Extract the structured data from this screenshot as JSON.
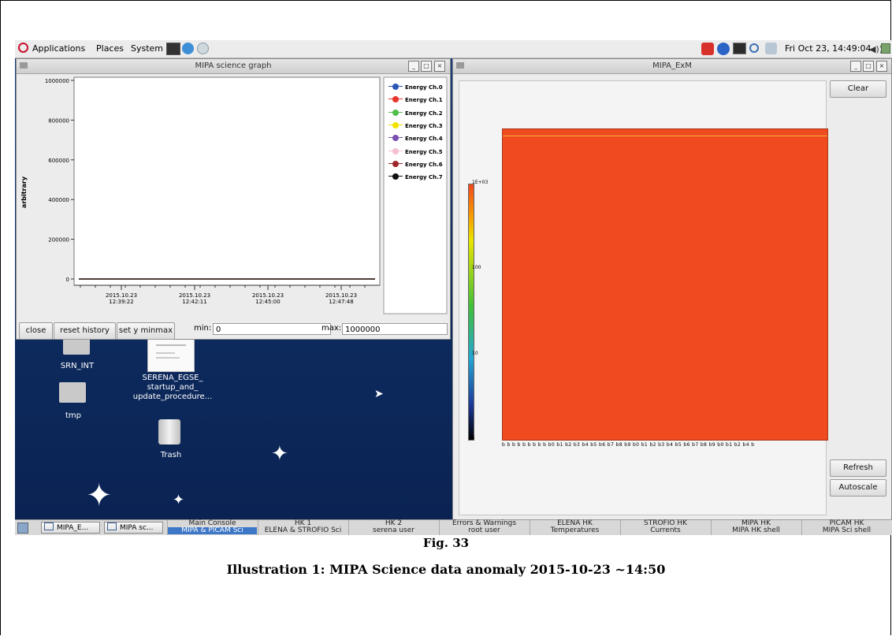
{
  "topbar": {
    "menus": [
      "Applications",
      "Places",
      "System"
    ],
    "clock": "Fri Oct 23, 14:49:04"
  },
  "graph_window": {
    "title": "MIPA science graph",
    "ylabel": "arbitrary",
    "yticks": [
      "1000000",
      "800000",
      "600000",
      "400000",
      "200000",
      "0"
    ],
    "xticks": [
      {
        "date": "2015.10.23",
        "time": "12:39:22"
      },
      {
        "date": "2015.10.23",
        "time": "12:42:11"
      },
      {
        "date": "2015.10.23",
        "time": "12:45:00"
      },
      {
        "date": "2015.10.23",
        "time": "12:47:48"
      }
    ],
    "legend": [
      {
        "label": "Energy Ch.0",
        "color": "#2b56b8"
      },
      {
        "label": "Energy Ch.1",
        "color": "#e8352a"
      },
      {
        "label": "Energy Ch.2",
        "color": "#4fbf4a"
      },
      {
        "label": "Energy Ch.3",
        "color": "#f2e200"
      },
      {
        "label": "Energy Ch.4",
        "color": "#7a4fb0"
      },
      {
        "label": "Energy Ch.5",
        "color": "#f4c0cf"
      },
      {
        "label": "Energy Ch.6",
        "color": "#a0262b"
      },
      {
        "label": "Energy Ch.7",
        "color": "#111111"
      }
    ],
    "buttons": {
      "close": "close",
      "reset": "reset history",
      "set_y": "set y minmax"
    },
    "min_label": "min:",
    "min_value": "0",
    "max_label": "max:",
    "max_value": "1000000"
  },
  "chart_data": {
    "type": "line",
    "title": "",
    "xlabel": "",
    "ylabel": "arbitrary",
    "ylim": [
      0,
      1000000
    ],
    "x": [
      "2015.10.23 12:39:22",
      "2015.10.23 12:42:11",
      "2015.10.23 12:45:00",
      "2015.10.23 12:47:48"
    ],
    "series": [
      {
        "name": "Energy Ch.0",
        "values": [
          0,
          0,
          0,
          0
        ]
      },
      {
        "name": "Energy Ch.1",
        "values": [
          0,
          0,
          0,
          0
        ]
      },
      {
        "name": "Energy Ch.2",
        "values": [
          0,
          0,
          0,
          0
        ]
      },
      {
        "name": "Energy Ch.3",
        "values": [
          0,
          0,
          0,
          0
        ]
      },
      {
        "name": "Energy Ch.4",
        "values": [
          0,
          0,
          0,
          0
        ]
      },
      {
        "name": "Energy Ch.5",
        "values": [
          0,
          0,
          0,
          0
        ]
      },
      {
        "name": "Energy Ch.6",
        "values": [
          0,
          0,
          0,
          0
        ]
      },
      {
        "name": "Energy Ch.7",
        "values": [
          0,
          0,
          0,
          0
        ]
      }
    ],
    "grid": false,
    "legend": "right"
  },
  "exm_window": {
    "title": "MIPA_ExM",
    "buttons": {
      "clear": "Clear",
      "refresh": "Refresh",
      "autoscale": "Autoscale"
    },
    "colorbar_labels": [
      "1E+03",
      "100",
      "10",
      "1"
    ],
    "heatmap_color": "#f04a1f",
    "bin_labels": "b b b b b b b b b b0 b1 b2 b3 b4 b5 b6 b7 b8 b9 b0 b1 b2 b3 b4 b5 b6 b7 b8 b9 b0 b1 b2 b4 b"
  },
  "desktop": {
    "icons": [
      {
        "label": "SRN_INT",
        "icon": "folder-icon"
      },
      {
        "label": "SERENA_EGSE_ startup_and_ update_procedure...",
        "icon": "document-icon"
      },
      {
        "label": "tmp",
        "icon": "folder-icon"
      },
      {
        "label": "Trash",
        "icon": "trash-icon"
      }
    ]
  },
  "taskbar": {
    "tasks": [
      "MIPA_E...",
      "MIPA sc..."
    ],
    "workspaces": [
      {
        "top": "Main Console",
        "bottom": "MIPA & PICAM Sci"
      },
      {
        "top": "HK 1",
        "bottom": "ELENA & STROFIO Sci"
      },
      {
        "top": "HK 2",
        "bottom": "serena user"
      },
      {
        "top": "Errors & Warnings",
        "bottom": "root user"
      },
      {
        "top": "ELENA HK",
        "bottom": "Temperatures"
      },
      {
        "top": "STROFIO HK",
        "bottom": "Currents"
      },
      {
        "top": "MIPA HK",
        "bottom": "MIPA HK shell"
      },
      {
        "top": "PICAM HK",
        "bottom": "MIPA Sci shell"
      }
    ]
  },
  "caption": {
    "fig": "Fig. 33",
    "title": "Illustration 1: MIPA Science data anomaly 2015-10-23 ~14:50"
  }
}
